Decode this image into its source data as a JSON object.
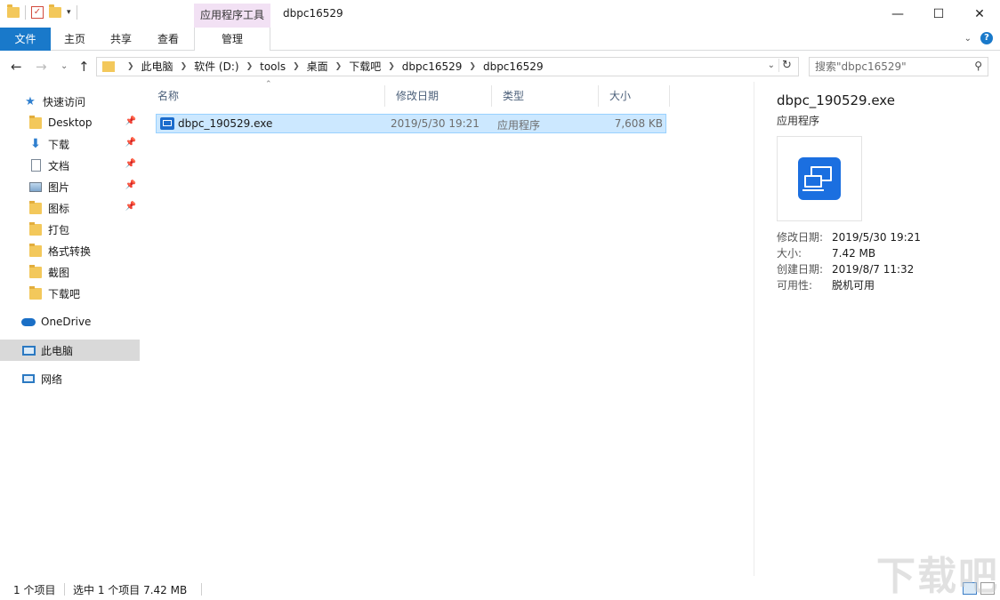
{
  "titlebar": {
    "context_tab_header": "应用程序工具",
    "window_title": "dbpc16529",
    "minimize": "—",
    "maximize": "☐",
    "close": "✕"
  },
  "ribbon": {
    "tabs": [
      {
        "label": "文件"
      },
      {
        "label": "主页"
      },
      {
        "label": "共享"
      },
      {
        "label": "查看"
      },
      {
        "label": "管理"
      }
    ]
  },
  "address": {
    "breadcrumbs": [
      "此电脑",
      "软件 (D:)",
      "tools",
      "桌面",
      "下载吧",
      "dbpc16529",
      "dbpc16529"
    ]
  },
  "search": {
    "placeholder": "搜索\"dbpc16529\""
  },
  "nav": {
    "quick_access": "快速访问",
    "items": [
      {
        "label": "Desktop",
        "icon": "folder-icon",
        "pinned": true
      },
      {
        "label": "下载",
        "icon": "download-icon",
        "pinned": true
      },
      {
        "label": "文档",
        "icon": "document-icon",
        "pinned": true
      },
      {
        "label": "图片",
        "icon": "picture-icon",
        "pinned": true
      },
      {
        "label": "图标",
        "icon": "folder-icon",
        "pinned": true
      },
      {
        "label": "打包",
        "icon": "folder-icon",
        "pinned": false
      },
      {
        "label": "格式转换",
        "icon": "folder-icon",
        "pinned": false
      },
      {
        "label": "截图",
        "icon": "folder-icon",
        "pinned": false
      },
      {
        "label": "下载吧",
        "icon": "folder-icon",
        "pinned": false
      }
    ],
    "onedrive": "OneDrive",
    "this_pc": "此电脑",
    "network": "网络"
  },
  "filelist": {
    "columns": {
      "name": "名称",
      "modified": "修改日期",
      "type": "类型",
      "size": "大小"
    },
    "rows": [
      {
        "name": "dbpc_190529.exe",
        "modified": "2019/5/30 19:21",
        "type": "应用程序",
        "size": "7,608 KB"
      }
    ]
  },
  "details": {
    "name": "dbpc_190529.exe",
    "type": "应用程序",
    "props": [
      {
        "key": "修改日期:",
        "value": "2019/5/30 19:21"
      },
      {
        "key": "大小:",
        "value": "7.42 MB"
      },
      {
        "key": "创建日期:",
        "value": "2019/8/7 11:32"
      },
      {
        "key": "可用性:",
        "value": "脱机可用"
      }
    ]
  },
  "status": {
    "count": "1 个项目",
    "selected": "选中 1 个项目  7.42 MB"
  },
  "watermark": "下载吧",
  "colors": {
    "accent": "#1979ca",
    "context_tab": "#f2e1f4",
    "selection": "#cce8ff"
  }
}
